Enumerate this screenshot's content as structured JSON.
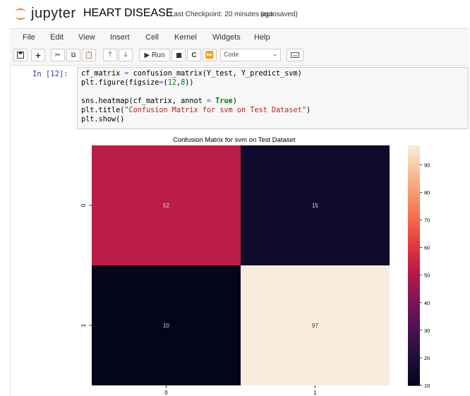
{
  "header": {
    "logo_text": "jupyter",
    "notebook_name": "HEART DISEASE",
    "checkpoint": "Last Checkpoint: 20 minutes ago",
    "autosave_status": "(autosaved)"
  },
  "menu": [
    "File",
    "Edit",
    "View",
    "Insert",
    "Cell",
    "Kernel",
    "Widgets",
    "Help"
  ],
  "toolbar": {
    "run_label": "Run",
    "cell_type": "Code"
  },
  "cell": {
    "prompt": "In [12]:"
  },
  "chart_data": {
    "type": "heatmap",
    "title": "Confusion Matrix for svm on Test Dataset",
    "x_ticks": [
      "0",
      "1"
    ],
    "y_ticks": [
      "0",
      "1"
    ],
    "values": [
      [
        52,
        15
      ],
      [
        10,
        97
      ]
    ],
    "colorbar": {
      "ticks": [
        10,
        20,
        30,
        40,
        50,
        60,
        70,
        80,
        90
      ],
      "range": [
        10,
        97
      ]
    },
    "colors": {
      "low": "#0d0a29",
      "mid": "#e8434c",
      "high": "#fae6d6"
    }
  }
}
